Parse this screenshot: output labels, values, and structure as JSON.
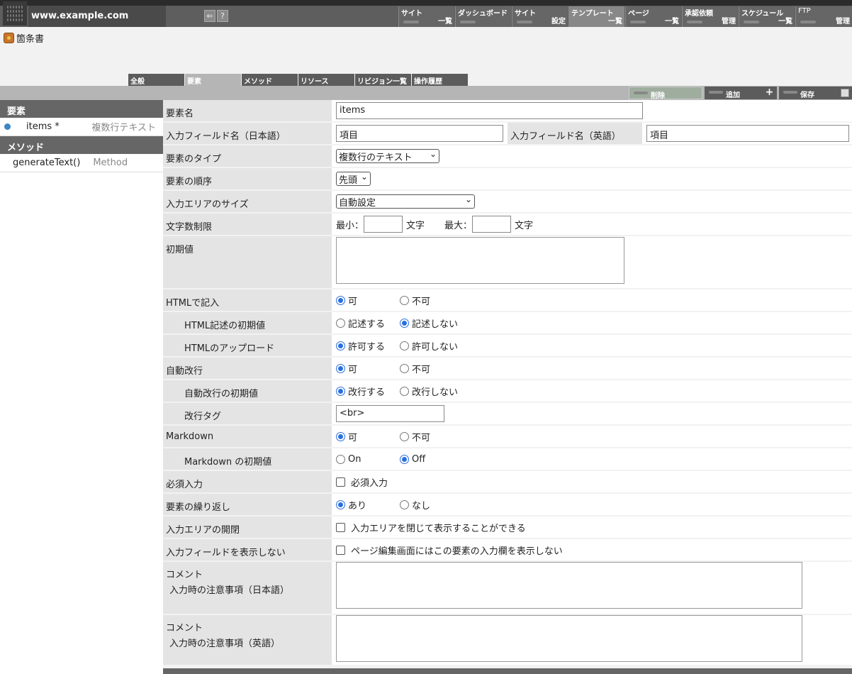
{
  "header": {
    "domain": "www.example.com",
    "icons": [
      "back-icon",
      "help-icon"
    ],
    "help_glyph": "?",
    "back_glyph": "⇐"
  },
  "nav": [
    {
      "top": "サイト",
      "bottom": "一覧"
    },
    {
      "top": "ダッシュボード",
      "bottom": ""
    },
    {
      "top": "サイト",
      "bottom": "設定"
    },
    {
      "top": "テンプレート",
      "bottom": "一覧"
    },
    {
      "top": "ページ",
      "bottom": "一覧"
    },
    {
      "top": "承認依頼",
      "bottom": "管理"
    },
    {
      "top": "スケジュール",
      "bottom": "一覧"
    },
    {
      "top": "FTP",
      "bottom": "管理"
    }
  ],
  "doc_title": "箇条書",
  "tabs": [
    "全般",
    "要素",
    "メソッド",
    "リソース",
    "リビジョン一覧",
    "操作履歴"
  ],
  "actions": {
    "delete": "削除",
    "add": "追加",
    "save": "保存"
  },
  "sidebar": {
    "elements_head": "要素",
    "item_name": "items *",
    "item_type": "複数行テキスト",
    "methods_head": "メソッド",
    "method_name": "generateText()",
    "method_type": "Method"
  },
  "form": {
    "name_label": "要素名",
    "name_value": "items",
    "field_ja_label": "入力フィールド名（日本語）",
    "field_ja_value": "項目",
    "field_en_label": "入力フィールド名（英語）",
    "field_en_value": "項目",
    "type_label": "要素のタイプ",
    "type_value": "複数行のテキスト",
    "order_label": "要素の順序",
    "order_value": "先頭",
    "size_label": "入力エリアのサイズ",
    "size_value": "自動設定",
    "limit_label": "文字数制限",
    "limit_min": "最小：",
    "limit_max": "最大：",
    "limit_unit": "文字",
    "default_label": "初期値",
    "html_label": "HTMLで記入",
    "yes": "可",
    "no": "不可",
    "html_default_label": "HTML記述の初期値",
    "html_default_yes": "記述する",
    "html_default_no": "記述しない",
    "html_upload_label": "HTMLのアップロード",
    "allow": "許可する",
    "disallow": "許可しない",
    "autobr_label": "自動改行",
    "autobr_default_label": "自動改行の初期値",
    "autobr_yes": "改行する",
    "autobr_no": "改行しない",
    "brtag_label": "改行タグ",
    "brtag_value": "<br>",
    "md_label": "Markdown",
    "md_default_label": "Markdown の初期値",
    "on": "On",
    "off": "Off",
    "required_label": "必須入力",
    "required_text": "必須入力",
    "repeat_label": "要素の繰り返し",
    "repeat_yes": "あり",
    "repeat_no": "なし",
    "collapse_label": "入力エリアの開閉",
    "collapse_text": "入力エリアを閉じて表示することができる",
    "hide_label": "入力フィールドを表示しない",
    "hide_text": "ページ編集画面にはこの要素の入力欄を表示しない",
    "comment_label": "コメント",
    "comment_ja_sub": "入力時の注意事項（日本語）",
    "comment_en_sub": "入力時の注意事項（英語）"
  }
}
